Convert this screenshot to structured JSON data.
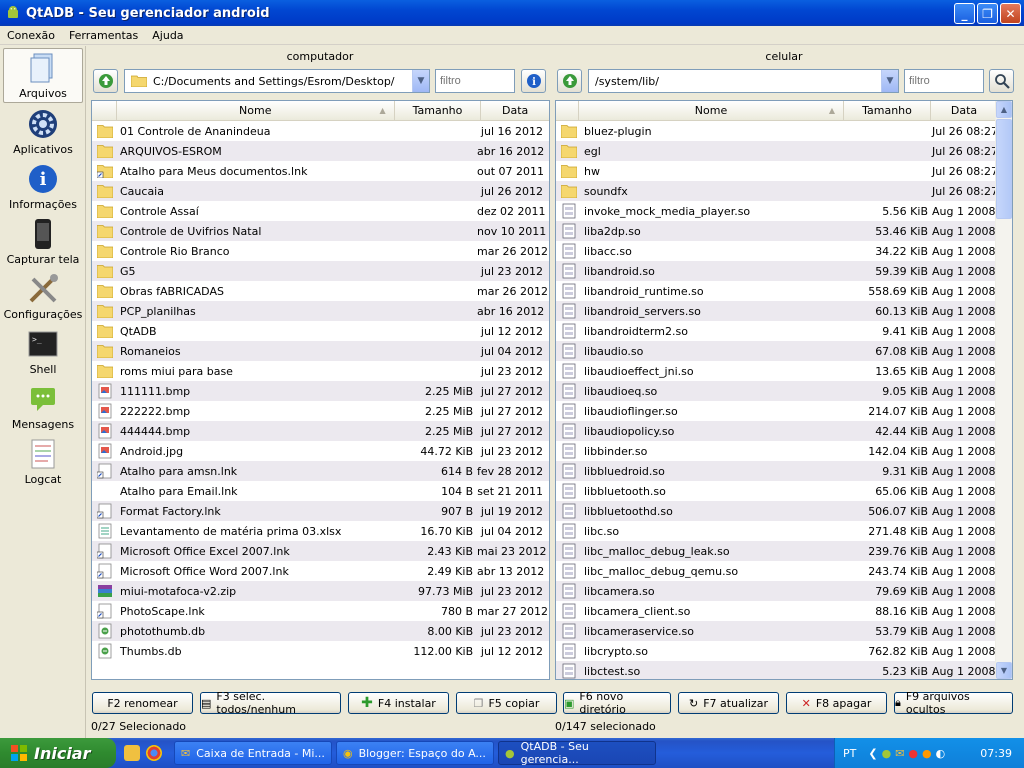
{
  "window": {
    "title": "QtADB - Seu gerenciador android"
  },
  "menu": [
    "Conexão",
    "Ferramentas",
    "Ajuda"
  ],
  "sidebar": [
    {
      "label": "Arquivos",
      "icon": "files-icon"
    },
    {
      "label": "Aplicativos",
      "icon": "gear-icon"
    },
    {
      "label": "Informações",
      "icon": "info-icon"
    },
    {
      "label": "Capturar tela",
      "icon": "phone-icon"
    },
    {
      "label": "Configurações",
      "icon": "tools-icon"
    },
    {
      "label": "Shell",
      "icon": "terminal-icon"
    },
    {
      "label": "Mensagens",
      "icon": "message-icon"
    },
    {
      "label": "Logcat",
      "icon": "log-icon"
    }
  ],
  "computer": {
    "title": "computador",
    "path": "C:/Documents and Settings/Esrom/Desktop/",
    "filter_placeholder": "filtro",
    "columns": {
      "name": "Nome",
      "size": "Tamanho",
      "date": "Data"
    },
    "files": [
      {
        "name": "01 Controle de Ananindeua",
        "size": "",
        "date": "jul 16 2012",
        "type": "folder"
      },
      {
        "name": "ARQUIVOS-ESROM",
        "size": "",
        "date": "abr 16 2012",
        "type": "folder"
      },
      {
        "name": "Atalho para Meus documentos.lnk",
        "size": "",
        "date": "out 07 2011",
        "type": "folder-link"
      },
      {
        "name": "Caucaia",
        "size": "",
        "date": "jul 26 2012",
        "type": "folder"
      },
      {
        "name": "Controle Assaí",
        "size": "",
        "date": "dez 02 2011",
        "type": "folder"
      },
      {
        "name": "Controle de Uvifrios Natal",
        "size": "",
        "date": "nov 10 2011",
        "type": "folder"
      },
      {
        "name": "Controle Rio Branco",
        "size": "",
        "date": "mar 26 2012",
        "type": "folder"
      },
      {
        "name": "G5",
        "size": "",
        "date": "jul 23 2012",
        "type": "folder"
      },
      {
        "name": "Obras fABRICADAS",
        "size": "",
        "date": "mar 26 2012",
        "type": "folder"
      },
      {
        "name": "PCP_planilhas",
        "size": "",
        "date": "abr 16 2012",
        "type": "folder"
      },
      {
        "name": "QtADB",
        "size": "",
        "date": "jul 12 2012",
        "type": "folder"
      },
      {
        "name": "Romaneios",
        "size": "",
        "date": "jul 04 2012",
        "type": "folder"
      },
      {
        "name": "roms miui para base",
        "size": "",
        "date": "jul 23 2012",
        "type": "folder"
      },
      {
        "name": "111111.bmp",
        "size": "2.25 MiB",
        "date": "jul 27 2012",
        "type": "image"
      },
      {
        "name": "222222.bmp",
        "size": "2.25 MiB",
        "date": "jul 27 2012",
        "type": "image"
      },
      {
        "name": "444444.bmp",
        "size": "2.25 MiB",
        "date": "jul 27 2012",
        "type": "image"
      },
      {
        "name": "Android.jpg",
        "size": "44.72 KiB",
        "date": "jul 23 2012",
        "type": "image"
      },
      {
        "name": "Atalho para amsn.lnk",
        "size": "614 B",
        "date": "fev 28 2012",
        "type": "link"
      },
      {
        "name": "Atalho para Email.lnk",
        "size": "104 B",
        "date": "set 21 2011",
        "type": "blank"
      },
      {
        "name": "Format Factory.lnk",
        "size": "907 B",
        "date": "jul 19 2012",
        "type": "link"
      },
      {
        "name": "Levantamento de matéria prima 03.xlsx",
        "size": "16.70 KiB",
        "date": "jul 04 2012",
        "type": "doc"
      },
      {
        "name": "Microsoft Office Excel 2007.lnk",
        "size": "2.43 KiB",
        "date": "mai 23 2012",
        "type": "link"
      },
      {
        "name": "Microsoft Office Word 2007.lnk",
        "size": "2.49 KiB",
        "date": "abr 13 2012",
        "type": "link"
      },
      {
        "name": "miui-motafoca-v2.zip",
        "size": "97.73 MiB",
        "date": "jul 23 2012",
        "type": "zip"
      },
      {
        "name": "PhotoScape.lnk",
        "size": "780 B",
        "date": "mar 27 2012",
        "type": "link"
      },
      {
        "name": "photothumb.db",
        "size": "8.00 KiB",
        "date": "jul 23 2012",
        "type": "db"
      },
      {
        "name": "Thumbs.db",
        "size": "112.00 KiB",
        "date": "jul 12 2012",
        "type": "db"
      }
    ],
    "status": "0/27 Selecionado"
  },
  "phone": {
    "title": "celular",
    "path": "/system/lib/",
    "filter_placeholder": "filtro",
    "columns": {
      "name": "Nome",
      "size": "Tamanho",
      "date": "Data"
    },
    "files": [
      {
        "name": "bluez-plugin",
        "size": "",
        "date": "Jul 26 08:27",
        "type": "folder"
      },
      {
        "name": "egl",
        "size": "",
        "date": "Jul 26 08:27",
        "type": "folder"
      },
      {
        "name": "hw",
        "size": "",
        "date": "Jul 26 08:27",
        "type": "folder"
      },
      {
        "name": "soundfx",
        "size": "",
        "date": "Jul 26 08:27",
        "type": "folder"
      },
      {
        "name": "invoke_mock_media_player.so",
        "size": "5.56 KiB",
        "date": "Aug 1 2008",
        "type": "file"
      },
      {
        "name": "liba2dp.so",
        "size": "53.46 KiB",
        "date": "Aug 1 2008",
        "type": "file"
      },
      {
        "name": "libacc.so",
        "size": "34.22 KiB",
        "date": "Aug 1 2008",
        "type": "file"
      },
      {
        "name": "libandroid.so",
        "size": "59.39 KiB",
        "date": "Aug 1 2008",
        "type": "file"
      },
      {
        "name": "libandroid_runtime.so",
        "size": "558.69 KiB",
        "date": "Aug 1 2008",
        "type": "file"
      },
      {
        "name": "libandroid_servers.so",
        "size": "60.13 KiB",
        "date": "Aug 1 2008",
        "type": "file"
      },
      {
        "name": "libandroidterm2.so",
        "size": "9.41 KiB",
        "date": "Aug 1 2008",
        "type": "file"
      },
      {
        "name": "libaudio.so",
        "size": "67.08 KiB",
        "date": "Aug 1 2008",
        "type": "file"
      },
      {
        "name": "libaudioeffect_jni.so",
        "size": "13.65 KiB",
        "date": "Aug 1 2008",
        "type": "file"
      },
      {
        "name": "libaudioeq.so",
        "size": "9.05 KiB",
        "date": "Aug 1 2008",
        "type": "file"
      },
      {
        "name": "libaudioflinger.so",
        "size": "214.07 KiB",
        "date": "Aug 1 2008",
        "type": "file"
      },
      {
        "name": "libaudiopolicy.so",
        "size": "42.44 KiB",
        "date": "Aug 1 2008",
        "type": "file"
      },
      {
        "name": "libbinder.so",
        "size": "142.04 KiB",
        "date": "Aug 1 2008",
        "type": "file"
      },
      {
        "name": "libbluedroid.so",
        "size": "9.31 KiB",
        "date": "Aug 1 2008",
        "type": "file"
      },
      {
        "name": "libbluetooth.so",
        "size": "65.06 KiB",
        "date": "Aug 1 2008",
        "type": "file"
      },
      {
        "name": "libbluetoothd.so",
        "size": "506.07 KiB",
        "date": "Aug 1 2008",
        "type": "file"
      },
      {
        "name": "libc.so",
        "size": "271.48 KiB",
        "date": "Aug 1 2008",
        "type": "file"
      },
      {
        "name": "libc_malloc_debug_leak.so",
        "size": "239.76 KiB",
        "date": "Aug 1 2008",
        "type": "file"
      },
      {
        "name": "libc_malloc_debug_qemu.so",
        "size": "243.74 KiB",
        "date": "Aug 1 2008",
        "type": "file"
      },
      {
        "name": "libcamera.so",
        "size": "79.69 KiB",
        "date": "Aug 1 2008",
        "type": "file"
      },
      {
        "name": "libcamera_client.so",
        "size": "88.16 KiB",
        "date": "Aug 1 2008",
        "type": "file"
      },
      {
        "name": "libcameraservice.so",
        "size": "53.79 KiB",
        "date": "Aug 1 2008",
        "type": "file"
      },
      {
        "name": "libcrypto.so",
        "size": "762.82 KiB",
        "date": "Aug 1 2008",
        "type": "file"
      },
      {
        "name": "libctest.so",
        "size": "5.23 KiB",
        "date": "Aug 1 2008",
        "type": "file"
      }
    ],
    "status": "0/147 selecionado"
  },
  "buttons": [
    {
      "label": "F2 renomear",
      "icon": ""
    },
    {
      "label": "F3 selec. todos/nenhum",
      "icon": "select-all-icon"
    },
    {
      "label": "F4 instalar",
      "icon": "plus-icon"
    },
    {
      "label": "F5 copiar",
      "icon": "copy-icon"
    },
    {
      "label": "F6 novo diretório",
      "icon": "new-folder-icon"
    },
    {
      "label": "F7 atualizar",
      "icon": "refresh-icon"
    },
    {
      "label": "F8 apagar",
      "icon": "delete-icon"
    },
    {
      "label": "F9 arquivos ocultos",
      "icon": "hidden-files-icon"
    }
  ],
  "taskbar": {
    "start": "Iniciar",
    "tasks": [
      "Caixa de Entrada - Mi...",
      "Blogger: Espaço do A...",
      "QtADB - Seu gerencia..."
    ],
    "lang": "PT",
    "clock": "07:39"
  }
}
